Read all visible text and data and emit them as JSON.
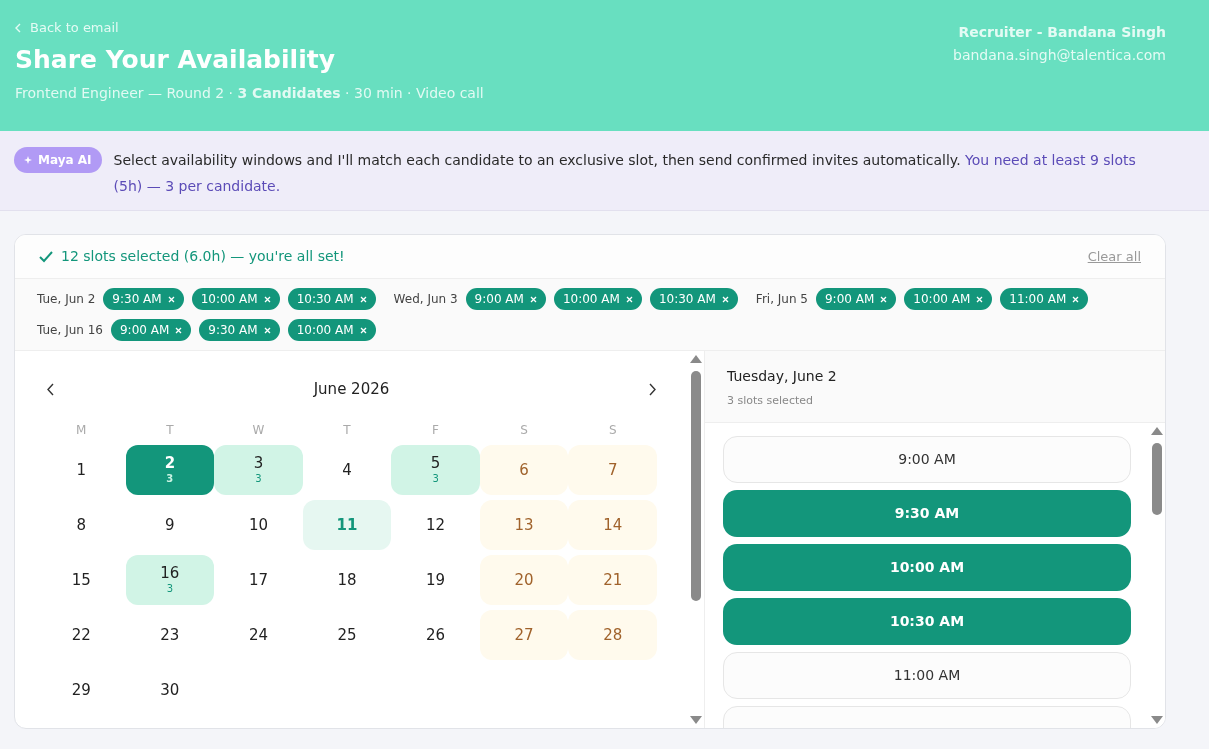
{
  "header": {
    "back_link": "Back to email",
    "title": "Share Your Availability",
    "subtitle": "Frontend Engineer — Round 2 · **3 Candidates** · 30 min · Video call",
    "recruiter": "Recruiter - Bandana Singh",
    "email": "bandana.singh@talentica.com"
  },
  "assistant": {
    "badge": "Maya AI",
    "message": "Select availability windows and I'll match each candidate to an exclusive slot, then send confirmed invites automatically.",
    "requirement": "You need at least 9 slots (5h) — 3 per candidate."
  },
  "summary": {
    "status": "12 slots selected (6.0h) — you're all set!",
    "complete": true,
    "clear_link": "Clear all"
  },
  "selected_groups": [
    {
      "date": "Tue, Jun 2",
      "slots": [
        "9:30 AM",
        "10:00 AM",
        "10:30 AM"
      ]
    },
    {
      "date": "Wed, Jun 3",
      "slots": [
        "9:00 AM",
        "10:00 AM",
        "10:30 AM"
      ]
    },
    {
      "date": "Fri, Jun 5",
      "slots": [
        "9:00 AM",
        "10:00 AM",
        "11:00 AM"
      ]
    },
    {
      "date": "Tue, Jun 16",
      "slots": [
        "9:00 AM",
        "9:30 AM",
        "10:00 AM"
      ]
    }
  ],
  "calendar": {
    "month": "June 2026",
    "weekdays": [
      "M",
      "T",
      "W",
      "T",
      "F",
      "S",
      "S"
    ],
    "days": [
      {
        "day": "1",
        "kind": "plain"
      },
      {
        "day": "2",
        "kind": "selected",
        "count": "3"
      },
      {
        "day": "3",
        "kind": "has_slots",
        "count": "3"
      },
      {
        "day": "4",
        "kind": "plain"
      },
      {
        "day": "5",
        "kind": "has_slots",
        "count": "3"
      },
      {
        "day": "6",
        "kind": "weekend"
      },
      {
        "day": "7",
        "kind": "weekend"
      },
      {
        "day": "8",
        "kind": "plain"
      },
      {
        "day": "9",
        "kind": "plain"
      },
      {
        "day": "10",
        "kind": "plain"
      },
      {
        "day": "11",
        "kind": "today"
      },
      {
        "day": "12",
        "kind": "plain"
      },
      {
        "day": "13",
        "kind": "weekend"
      },
      {
        "day": "14",
        "kind": "weekend"
      },
      {
        "day": "15",
        "kind": "plain"
      },
      {
        "day": "16",
        "kind": "has_slots",
        "count": "3"
      },
      {
        "day": "17",
        "kind": "plain"
      },
      {
        "day": "18",
        "kind": "plain"
      },
      {
        "day": "19",
        "kind": "plain"
      },
      {
        "day": "20",
        "kind": "weekend"
      },
      {
        "day": "21",
        "kind": "weekend"
      },
      {
        "day": "22",
        "kind": "plain"
      },
      {
        "day": "23",
        "kind": "plain"
      },
      {
        "day": "24",
        "kind": "plain"
      },
      {
        "day": "25",
        "kind": "plain"
      },
      {
        "day": "26",
        "kind": "plain"
      },
      {
        "day": "27",
        "kind": "weekend"
      },
      {
        "day": "28",
        "kind": "weekend"
      },
      {
        "day": "29",
        "kind": "plain"
      },
      {
        "day": "30",
        "kind": "plain"
      }
    ]
  },
  "day_panel": {
    "title": "Tuesday, June 2",
    "subtitle": "3 slots selected",
    "slots": [
      {
        "time": "9:00 AM",
        "selected": false
      },
      {
        "time": "9:30 AM",
        "selected": true
      },
      {
        "time": "10:00 AM",
        "selected": true
      },
      {
        "time": "10:30 AM",
        "selected": true
      },
      {
        "time": "11:00 AM",
        "selected": false
      }
    ]
  }
}
